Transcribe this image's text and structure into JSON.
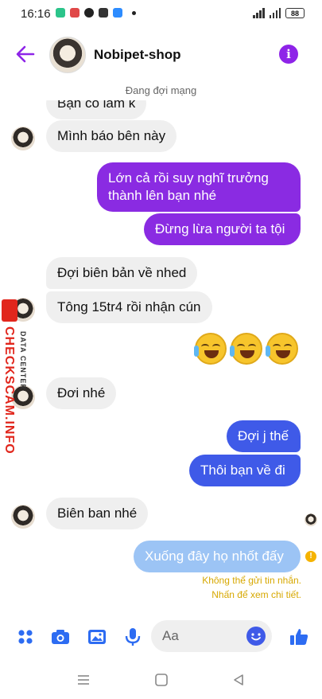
{
  "status_bar": {
    "time": "16:16",
    "battery": "88"
  },
  "header": {
    "title": "Nobipet-shop",
    "info_glyph": "i"
  },
  "network_status": "Đang đợi mạng",
  "messages": {
    "m0": "Bạn có làm k",
    "m1": "Mình báo bên này",
    "m2_line1": "Lớn cả rồi suy nghĩ trưởng",
    "m2_line2": "thành lên bạn nhé",
    "m3": "Đừng lừa người ta tội",
    "m4": "Đợi biên bản về nhed",
    "m5": "Tông 15tr4 rồi nhận cún",
    "m6": "Đơi nhé",
    "m7": "Đợi j thế",
    "m8": "Thôi bạn về đi",
    "m9": "Biên ban nhé",
    "m10": "Xuống đây họ nhốt đấy"
  },
  "send_error": {
    "line1": "Không thể gửi tin nhắn.",
    "line2": "Nhấn để xem chi tiết."
  },
  "watermark": {
    "brand": "CHECKSCAM.INFO",
    "sub": "DATA CENTER"
  },
  "composer": {
    "placeholder": "Aa"
  },
  "colors": {
    "accent_purple": "#8a2be2",
    "accent_blue": "#3f5ae8",
    "failed_blue": "#9cc4f5",
    "warning": "#f5b300"
  },
  "icons": [
    "back-arrow-icon",
    "info-icon",
    "menu-grid-icon",
    "camera-icon",
    "gallery-icon",
    "microphone-icon",
    "smile-icon",
    "thumbs-up-icon",
    "laughing-emoji"
  ]
}
